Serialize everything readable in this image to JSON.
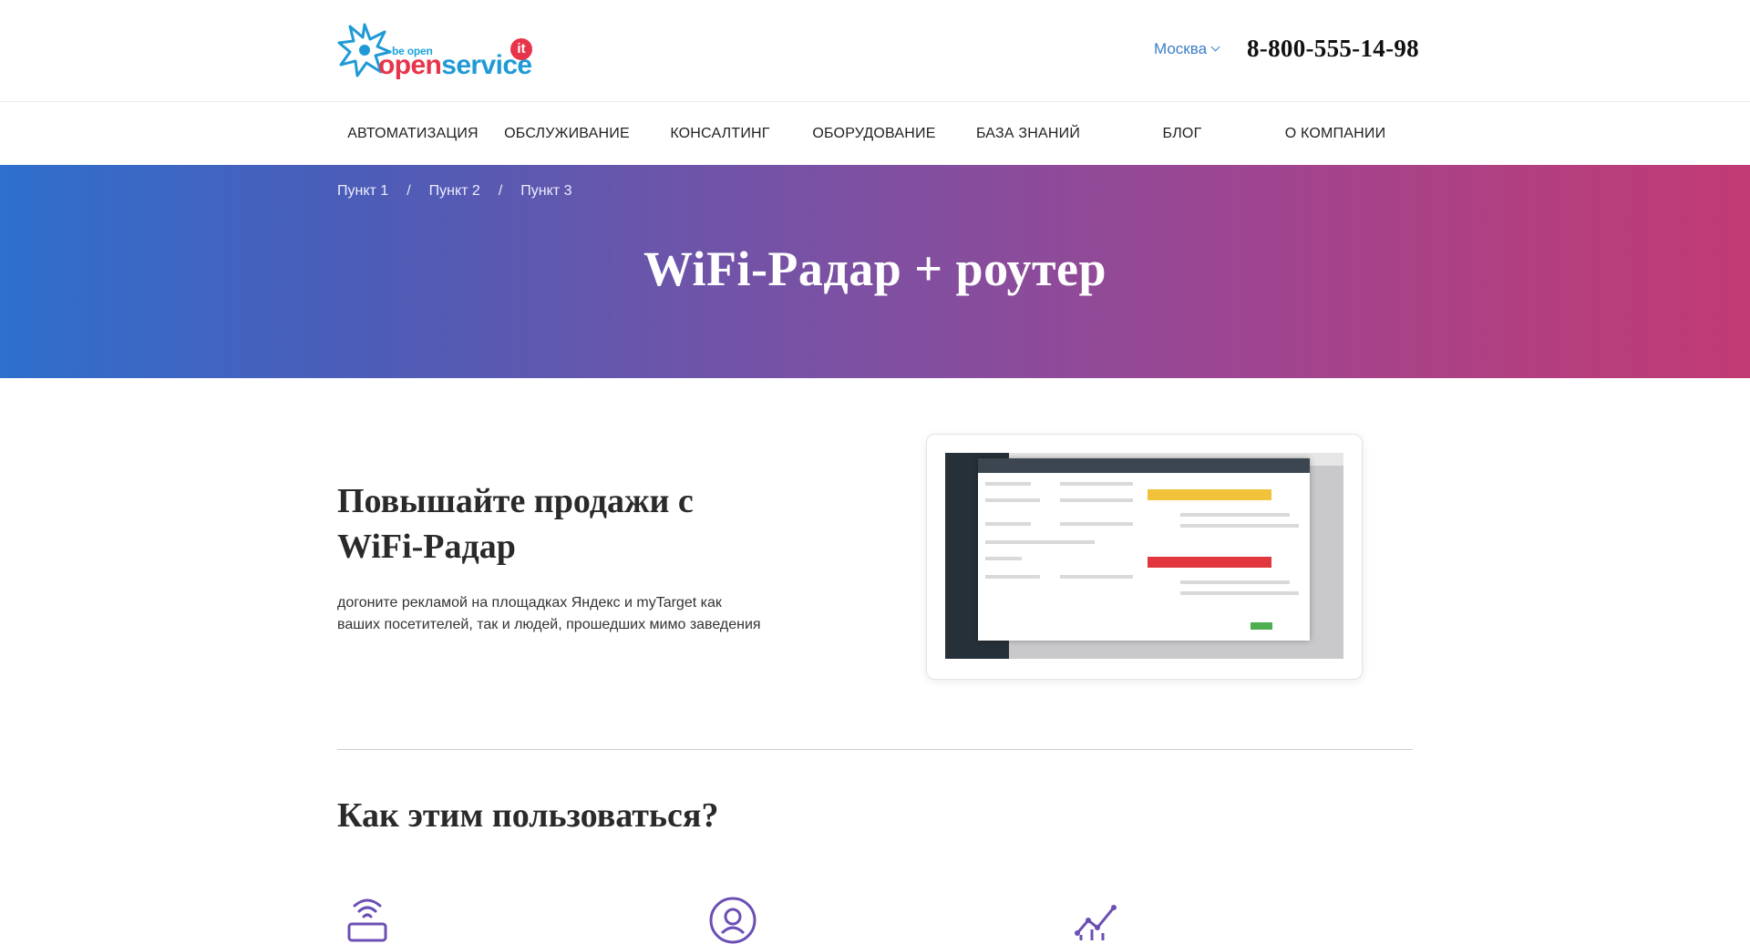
{
  "header": {
    "logo_tagline": "be open",
    "logo_word_part1": "open",
    "logo_word_part2": "service",
    "logo_badge": "it",
    "city": "Москва",
    "phone": "8-800-555-14-98"
  },
  "nav": {
    "items": [
      {
        "label": "АВТОМАТИЗАЦИЯ"
      },
      {
        "label": "ОБСЛУЖИВАНИЕ"
      },
      {
        "label": "КОНСАЛТИНГ"
      },
      {
        "label": "ОБОРУДОВАНИЕ"
      },
      {
        "label": "БАЗА ЗНАНИЙ"
      },
      {
        "label": "БЛОГ"
      },
      {
        "label": "О КОМПАНИИ"
      }
    ]
  },
  "breadcrumbs": {
    "items": [
      {
        "label": "Пункт 1"
      },
      {
        "label": "Пункт 2"
      },
      {
        "label": "Пункт 3"
      }
    ],
    "separator": "/"
  },
  "hero": {
    "title": "WiFi-Радар + роутер",
    "gradient_start": "#2f6fcd",
    "gradient_end": "#c13a73"
  },
  "feature": {
    "title": "Повышайте продажи с WiFi-Радар",
    "description_line1": "догоните рекламой на площадках Яндекс и myTarget как",
    "description_line2": "ваших посетителей, так и людей, прошедших мимо заведения"
  },
  "how": {
    "title": "Как этим пользоваться?",
    "icons": [
      "router-wifi-icon",
      "user-circle-icon",
      "growth-chart-icon"
    ]
  },
  "colors": {
    "accent_blue": "#3a7ec7",
    "brand_red": "#e8344a",
    "brand_blue": "#1f9ad6",
    "icon_purple": "#6b4fb5"
  }
}
